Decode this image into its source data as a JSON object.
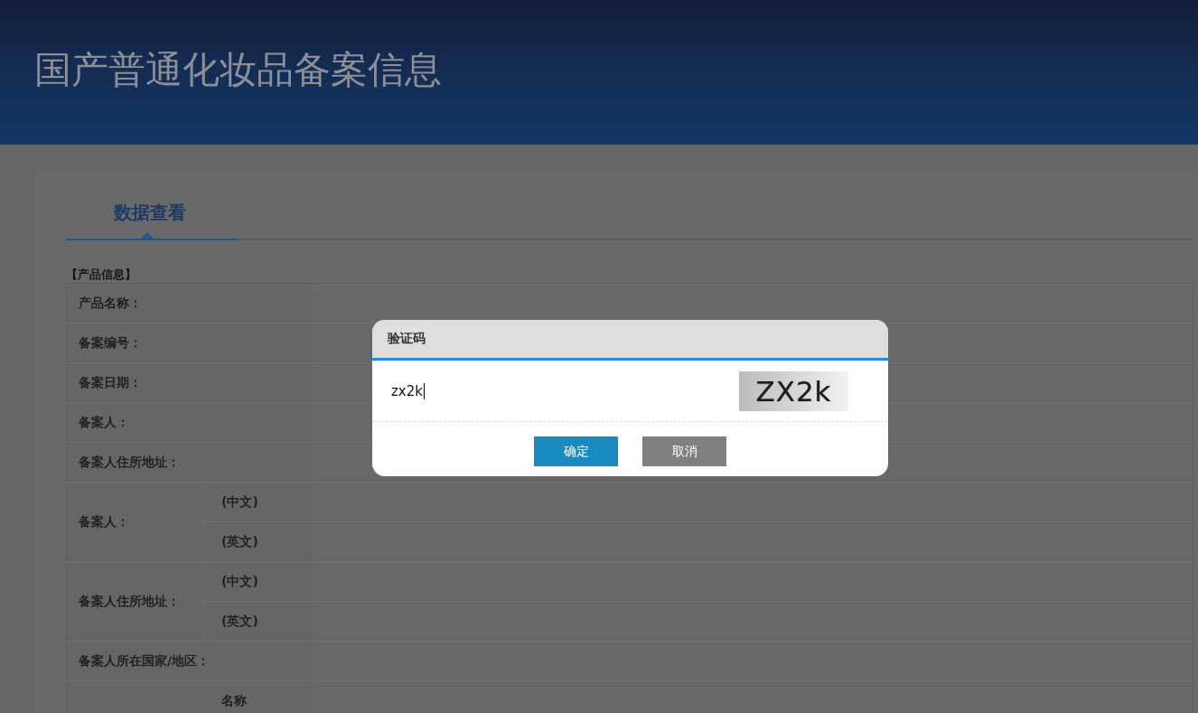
{
  "header": {
    "title": "国产普通化妆品备案信息"
  },
  "tabs": [
    {
      "label": "数据查看",
      "selected": true
    }
  ],
  "section": {
    "title": "【产品信息】"
  },
  "table": {
    "rows": [
      {
        "kind": "single",
        "label": "产品名称："
      },
      {
        "kind": "single",
        "label": "备案编号："
      },
      {
        "kind": "single",
        "label": "备案日期："
      },
      {
        "kind": "single",
        "label": "备案人："
      },
      {
        "kind": "single",
        "label": "备案人住所地址："
      },
      {
        "kind": "split",
        "label": "备案人：",
        "sublabels": [
          "(中文)",
          "(英文)"
        ]
      },
      {
        "kind": "split",
        "label": "备案人住所地址：",
        "sublabels": [
          "(中文)",
          "(英文)"
        ]
      },
      {
        "kind": "single",
        "label": "备案人所在国家/地区："
      },
      {
        "kind": "split",
        "sublabels": [
          "名称"
        ]
      }
    ]
  },
  "dialog": {
    "title": "验证码",
    "input": {
      "value": "zx2k"
    },
    "captcha": "ZX2k",
    "buttons": [
      {
        "label": "确定",
        "kind": "primary"
      },
      {
        "label": "取消",
        "kind": "secondary"
      }
    ]
  }
}
